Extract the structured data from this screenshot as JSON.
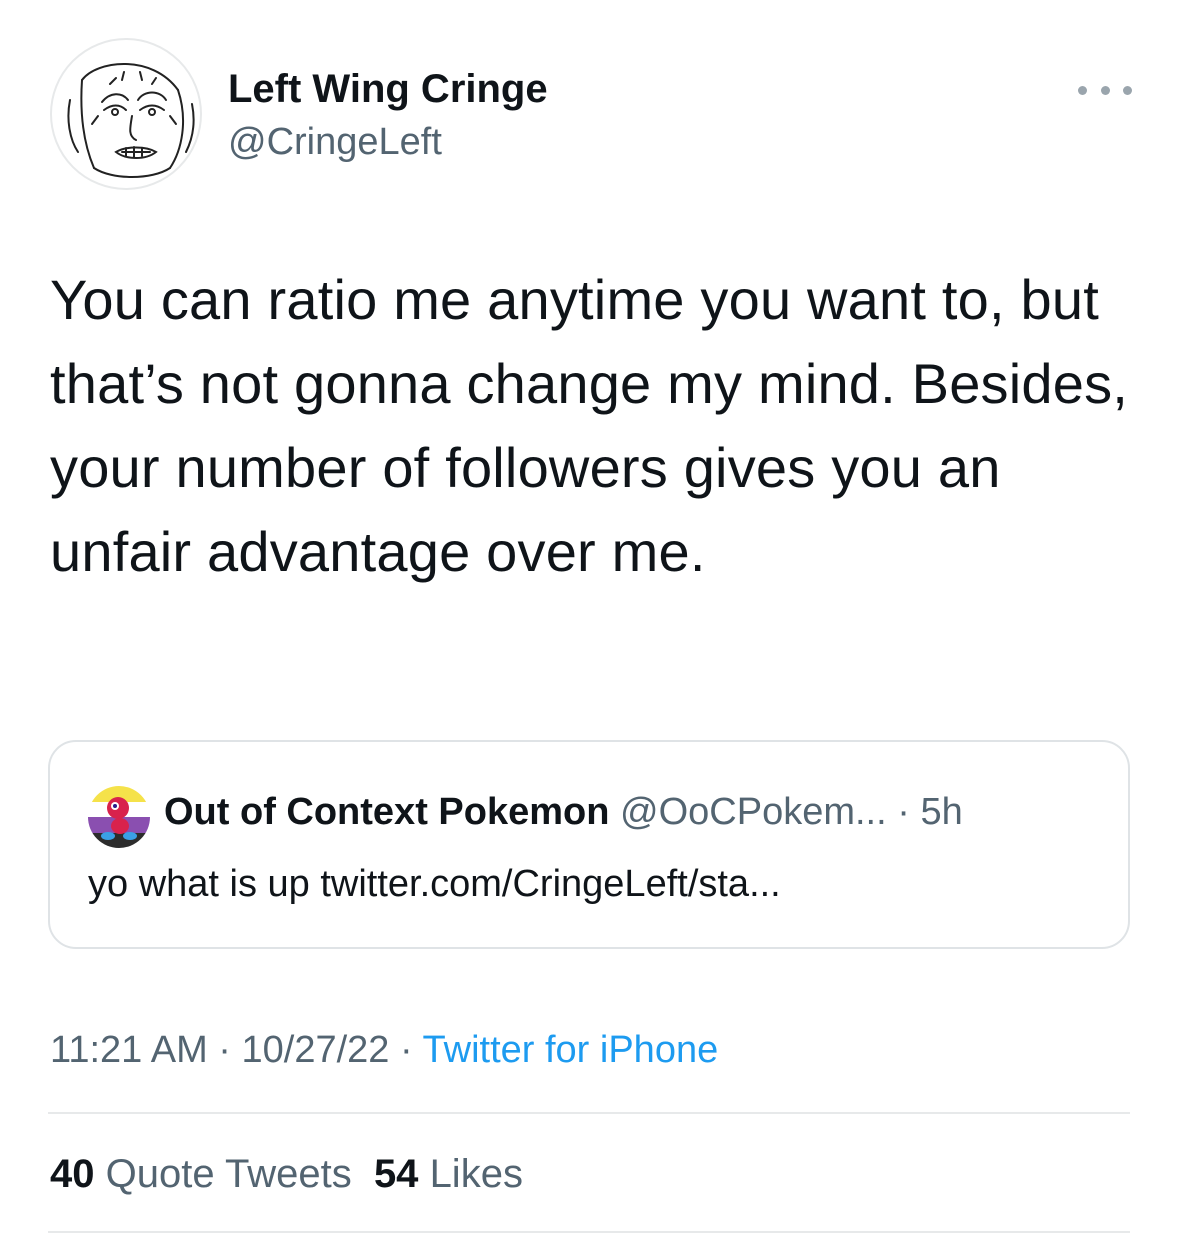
{
  "author": {
    "display_name": "Left Wing Cringe",
    "handle": "@CringeLeft",
    "avatar_icon": "wojak-sketch-avatar"
  },
  "more_icon": "more-horizontal-icon",
  "tweet": {
    "text": "You can ratio me anytime you want to, but that’s not gonna change my mind. Besides, your number of followers gives you an unfair advantage over me."
  },
  "quote": {
    "avatar_icon": "pokemon-avatar",
    "display_name": "Out of Context Pokemon",
    "handle": "@OoCPokem...",
    "separator": "·",
    "time": "5h",
    "text": "yo what is up twitter.com/CringeLeft/sta..."
  },
  "meta": {
    "time": "11:21 AM",
    "separator": "·",
    "date": "10/27/22",
    "source": "Twitter for iPhone"
  },
  "stats": {
    "quote_count": "40",
    "quote_label": "Quote Tweets",
    "like_count": "54",
    "like_label": "Likes"
  },
  "colors": {
    "text": "#0f1419",
    "secondary": "#536471",
    "link": "#1d9bf0",
    "border": "#e7e9ea"
  }
}
